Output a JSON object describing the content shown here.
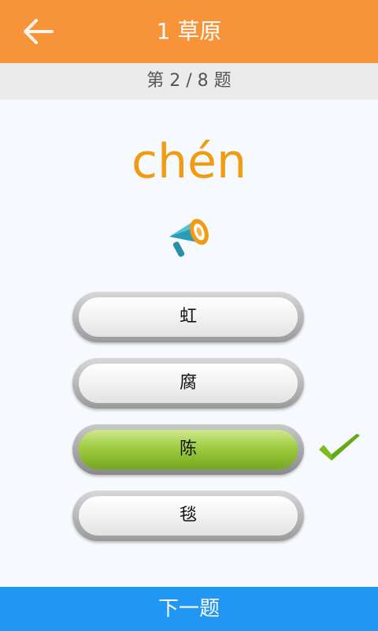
{
  "header": {
    "title": "1 草原",
    "back_icon": "arrow-left-icon",
    "color": "#f7943a"
  },
  "progress": {
    "text": "第 2 / 8 题"
  },
  "question": {
    "pinyin": "chén",
    "speaker_icon": "megaphone-icon",
    "pinyin_color": "#f29a12"
  },
  "options": [
    {
      "label": "虹",
      "state": "normal"
    },
    {
      "label": "腐",
      "state": "normal"
    },
    {
      "label": "陈",
      "state": "correct"
    },
    {
      "label": "毯",
      "state": "normal"
    }
  ],
  "feedback": {
    "icon": "checkmark-icon",
    "color": "#7cbd1e"
  },
  "footer": {
    "next_label": "下一题",
    "color": "#2196f3"
  }
}
